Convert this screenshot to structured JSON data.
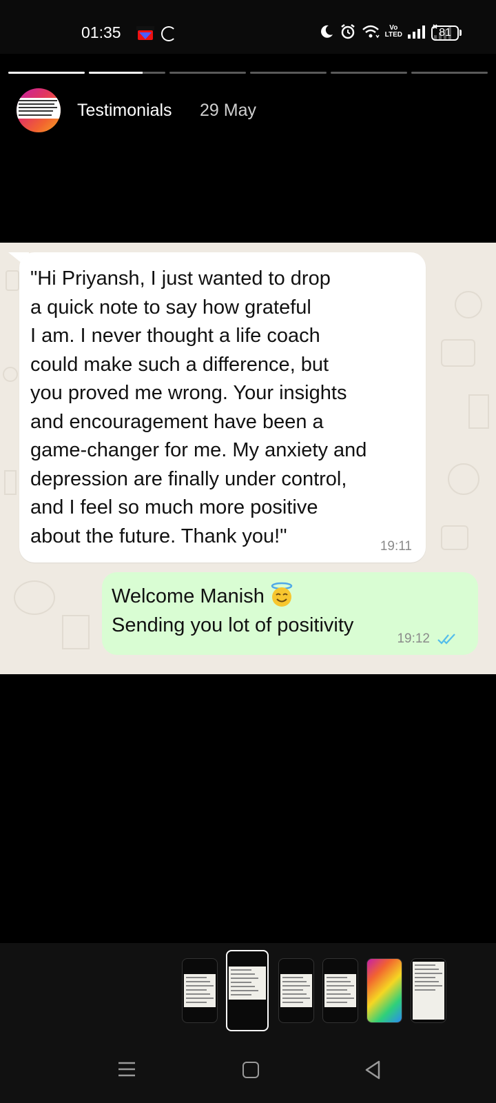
{
  "status_bar": {
    "time": "01:35",
    "battery": "81",
    "icons": [
      "sony-liv-icon",
      "loading-icon",
      "moon-icon",
      "alarm-icon",
      "wifi-icon",
      "volte-icon",
      "signal-icon",
      "signal-no-sim-icon",
      "battery-icon"
    ],
    "volte_top": "Vo",
    "volte_bottom": "LTE",
    "volte_mark": "D"
  },
  "story": {
    "segments_total": 6,
    "segments_done": 1,
    "current_progress": 0.7,
    "title": "Testimonials",
    "date": "29 May"
  },
  "chat": {
    "incoming": {
      "text": "\"Hi Priyansh, I just wanted to drop\na quick note to say how grateful\nI am. I never thought a life coach\ncould make such a difference, but\nyou proved me wrong. Your insights\nand encouragement have been a\ngame-changer for me. My anxiety and\ndepression are finally under control,\nand I feel so much more positive\nabout the future. Thank you!\"",
      "time": "19:11"
    },
    "outgoing": {
      "line1": "Welcome Manish",
      "line2": "Sending you lot of positivity",
      "time": "19:12",
      "emoji": "smiling-face-with-halo",
      "status": "read"
    }
  },
  "thumbnails": {
    "count": 6,
    "active_index": 1
  },
  "nav": {
    "icons": [
      "recent-apps-icon",
      "home-icon",
      "back-icon"
    ]
  },
  "colors": {
    "chat_bg": "#efeae2",
    "incoming_bubble": "#ffffff",
    "outgoing_bubble": "#d9fdd3",
    "read_ticks": "#53bdeb"
  }
}
